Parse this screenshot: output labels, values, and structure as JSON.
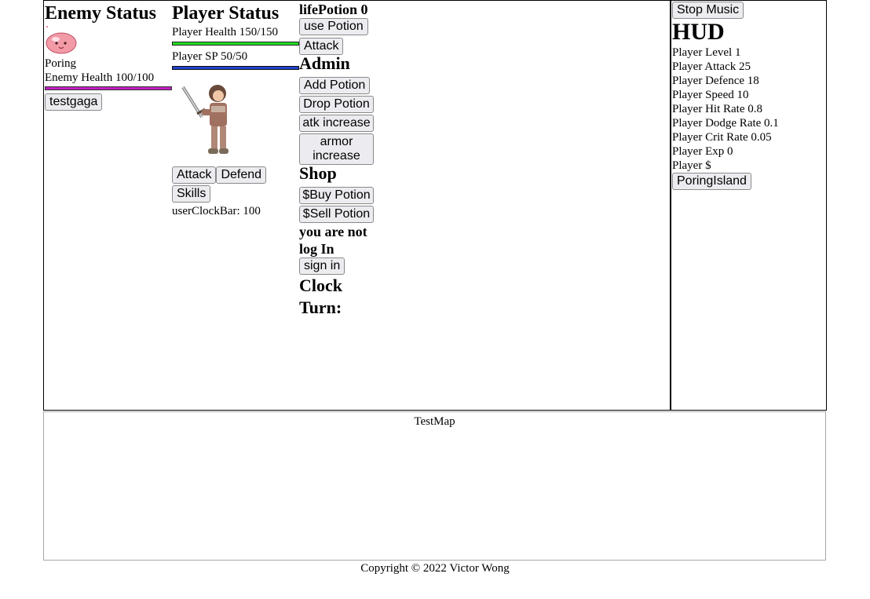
{
  "enemy": {
    "title": "Enemy Status",
    "name": "Poring",
    "health_label": "Enemy Health 100/100",
    "health_fraction": 1.0,
    "test_button": "testgaga",
    "sprite_icon": "poring-icon"
  },
  "player": {
    "title": "Player Status",
    "health_label": "Player Health 150/150",
    "health_fraction": 1.0,
    "sp_label": "Player SP 50/50",
    "sp_fraction": 1.0,
    "sprite_icon": "swordsman-icon",
    "attack_button": "Attack",
    "defend_button": "Defend",
    "skills_button": "Skills",
    "clock_label": "userClockBar: 100"
  },
  "actions": {
    "potion_label": "lifePotion 0",
    "use_potion_button": "use Potion",
    "attack_button": "Attack",
    "admin_title": "Admin",
    "add_potion_button": "Add Potion",
    "drop_potion_button": "Drop Potion",
    "atk_increase_button": "atk increase",
    "armor_increase_button": "armor increase",
    "shop_title": "Shop",
    "buy_potion_button": "$Buy Potion",
    "sell_potion_button": "$Sell Potion",
    "login_status": "you are not log In",
    "sign_in_button": "sign in",
    "clock_turn_label": "Clock Turn:"
  },
  "hud": {
    "stop_music_button": "Stop Music",
    "title": "HUD",
    "stats": [
      "Player Level 1",
      "Player Attack 25",
      "Player Defence 18",
      "Player Speed 10",
      "Player Hit Rate 0.8",
      "Player Dodge Rate 0.1",
      "Player Crit Rate 0.05",
      "Player Exp 0",
      "Player $"
    ],
    "map_button": "PoringIsland"
  },
  "map": {
    "title": "TestMap"
  },
  "footer": {
    "copyright": "Copyright © 2022 Victor Wong"
  },
  "colors": {
    "enemy_health_bar": "#c41ec4",
    "player_health_bar": "#22dd22",
    "player_sp_bar": "#2244cc"
  }
}
